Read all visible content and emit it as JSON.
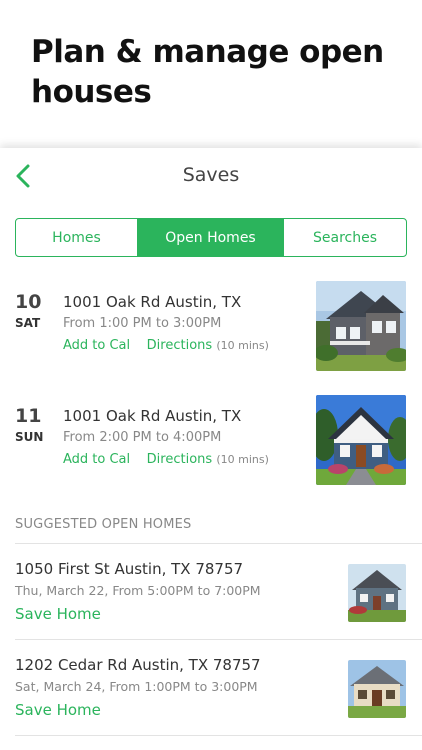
{
  "promo": {
    "title": "Plan & manage open houses"
  },
  "nav": {
    "title": "Saves",
    "back_icon": "chevron-left-icon"
  },
  "tabs": [
    {
      "label": "Homes",
      "active": false
    },
    {
      "label": "Open Homes",
      "active": true
    },
    {
      "label": "Searches",
      "active": false
    }
  ],
  "open_homes": [
    {
      "day": "10",
      "dow": "SAT",
      "address": "1001 Oak Rd Austin, TX",
      "time": "From 1:00 PM to 3:00PM",
      "add_to_cal": "Add to Cal",
      "directions": "Directions",
      "duration": "(10 mins)"
    },
    {
      "day": "11",
      "dow": "SUN",
      "address": "1001 Oak Rd Austin, TX",
      "time": "From 2:00 PM to 4:00PM",
      "add_to_cal": "Add to Cal",
      "directions": "Directions",
      "duration": "(10 mins)"
    }
  ],
  "suggested": {
    "header": "SUGGESTED OPEN HOMES",
    "items": [
      {
        "address": "1050 First St Austin, TX 78757",
        "when": "Thu, March 22, From 5:00PM to 7:00PM",
        "save": "Save Home"
      },
      {
        "address": "1202 Cedar Rd Austin, TX 78757",
        "when": "Sat, March 24, From 1:00PM to 3:00PM",
        "save": "Save Home"
      }
    ]
  },
  "colors": {
    "accent": "#2bb45c",
    "text": "#333333",
    "muted": "#888888"
  }
}
